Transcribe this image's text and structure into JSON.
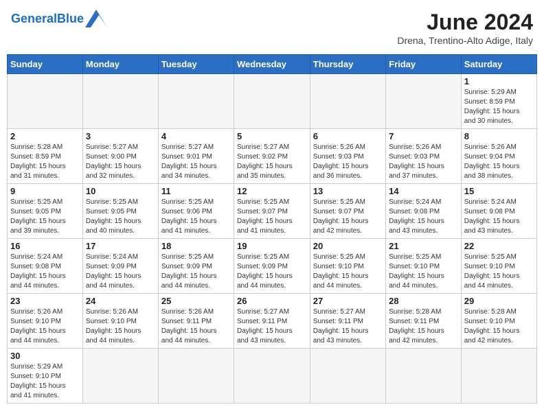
{
  "header": {
    "logo_text_normal": "General",
    "logo_text_blue": "Blue",
    "title": "June 2024",
    "subtitle": "Drena, Trentino-Alto Adige, Italy"
  },
  "weekdays": [
    "Sunday",
    "Monday",
    "Tuesday",
    "Wednesday",
    "Thursday",
    "Friday",
    "Saturday"
  ],
  "weeks": [
    [
      {
        "day": "",
        "info": ""
      },
      {
        "day": "",
        "info": ""
      },
      {
        "day": "",
        "info": ""
      },
      {
        "day": "",
        "info": ""
      },
      {
        "day": "",
        "info": ""
      },
      {
        "day": "",
        "info": ""
      },
      {
        "day": "1",
        "info": "Sunrise: 5:29 AM\nSunset: 8:59 PM\nDaylight: 15 hours\nand 30 minutes."
      }
    ],
    [
      {
        "day": "2",
        "info": "Sunrise: 5:28 AM\nSunset: 8:59 PM\nDaylight: 15 hours\nand 31 minutes."
      },
      {
        "day": "3",
        "info": "Sunrise: 5:27 AM\nSunset: 9:00 PM\nDaylight: 15 hours\nand 32 minutes."
      },
      {
        "day": "4",
        "info": "Sunrise: 5:27 AM\nSunset: 9:01 PM\nDaylight: 15 hours\nand 34 minutes."
      },
      {
        "day": "5",
        "info": "Sunrise: 5:27 AM\nSunset: 9:02 PM\nDaylight: 15 hours\nand 35 minutes."
      },
      {
        "day": "6",
        "info": "Sunrise: 5:26 AM\nSunset: 9:03 PM\nDaylight: 15 hours\nand 36 minutes."
      },
      {
        "day": "7",
        "info": "Sunrise: 5:26 AM\nSunset: 9:03 PM\nDaylight: 15 hours\nand 37 minutes."
      },
      {
        "day": "8",
        "info": "Sunrise: 5:26 AM\nSunset: 9:04 PM\nDaylight: 15 hours\nand 38 minutes."
      }
    ],
    [
      {
        "day": "9",
        "info": "Sunrise: 5:25 AM\nSunset: 9:05 PM\nDaylight: 15 hours\nand 39 minutes."
      },
      {
        "day": "10",
        "info": "Sunrise: 5:25 AM\nSunset: 9:05 PM\nDaylight: 15 hours\nand 40 minutes."
      },
      {
        "day": "11",
        "info": "Sunrise: 5:25 AM\nSunset: 9:06 PM\nDaylight: 15 hours\nand 41 minutes."
      },
      {
        "day": "12",
        "info": "Sunrise: 5:25 AM\nSunset: 9:07 PM\nDaylight: 15 hours\nand 41 minutes."
      },
      {
        "day": "13",
        "info": "Sunrise: 5:25 AM\nSunset: 9:07 PM\nDaylight: 15 hours\nand 42 minutes."
      },
      {
        "day": "14",
        "info": "Sunrise: 5:24 AM\nSunset: 9:08 PM\nDaylight: 15 hours\nand 43 minutes."
      },
      {
        "day": "15",
        "info": "Sunrise: 5:24 AM\nSunset: 9:08 PM\nDaylight: 15 hours\nand 43 minutes."
      }
    ],
    [
      {
        "day": "16",
        "info": "Sunrise: 5:24 AM\nSunset: 9:08 PM\nDaylight: 15 hours\nand 44 minutes."
      },
      {
        "day": "17",
        "info": "Sunrise: 5:24 AM\nSunset: 9:09 PM\nDaylight: 15 hours\nand 44 minutes."
      },
      {
        "day": "18",
        "info": "Sunrise: 5:25 AM\nSunset: 9:09 PM\nDaylight: 15 hours\nand 44 minutes."
      },
      {
        "day": "19",
        "info": "Sunrise: 5:25 AM\nSunset: 9:09 PM\nDaylight: 15 hours\nand 44 minutes."
      },
      {
        "day": "20",
        "info": "Sunrise: 5:25 AM\nSunset: 9:10 PM\nDaylight: 15 hours\nand 44 minutes."
      },
      {
        "day": "21",
        "info": "Sunrise: 5:25 AM\nSunset: 9:10 PM\nDaylight: 15 hours\nand 44 minutes."
      },
      {
        "day": "22",
        "info": "Sunrise: 5:25 AM\nSunset: 9:10 PM\nDaylight: 15 hours\nand 44 minutes."
      }
    ],
    [
      {
        "day": "23",
        "info": "Sunrise: 5:26 AM\nSunset: 9:10 PM\nDaylight: 15 hours\nand 44 minutes."
      },
      {
        "day": "24",
        "info": "Sunrise: 5:26 AM\nSunset: 9:10 PM\nDaylight: 15 hours\nand 44 minutes."
      },
      {
        "day": "25",
        "info": "Sunrise: 5:26 AM\nSunset: 9:11 PM\nDaylight: 15 hours\nand 44 minutes."
      },
      {
        "day": "26",
        "info": "Sunrise: 5:27 AM\nSunset: 9:11 PM\nDaylight: 15 hours\nand 43 minutes."
      },
      {
        "day": "27",
        "info": "Sunrise: 5:27 AM\nSunset: 9:11 PM\nDaylight: 15 hours\nand 43 minutes."
      },
      {
        "day": "28",
        "info": "Sunrise: 5:28 AM\nSunset: 9:11 PM\nDaylight: 15 hours\nand 42 minutes."
      },
      {
        "day": "29",
        "info": "Sunrise: 5:28 AM\nSunset: 9:10 PM\nDaylight: 15 hours\nand 42 minutes."
      }
    ],
    [
      {
        "day": "30",
        "info": "Sunrise: 5:29 AM\nSunset: 9:10 PM\nDaylight: 15 hours\nand 41 minutes."
      },
      {
        "day": "",
        "info": ""
      },
      {
        "day": "",
        "info": ""
      },
      {
        "day": "",
        "info": ""
      },
      {
        "day": "",
        "info": ""
      },
      {
        "day": "",
        "info": ""
      },
      {
        "day": "",
        "info": ""
      }
    ]
  ]
}
